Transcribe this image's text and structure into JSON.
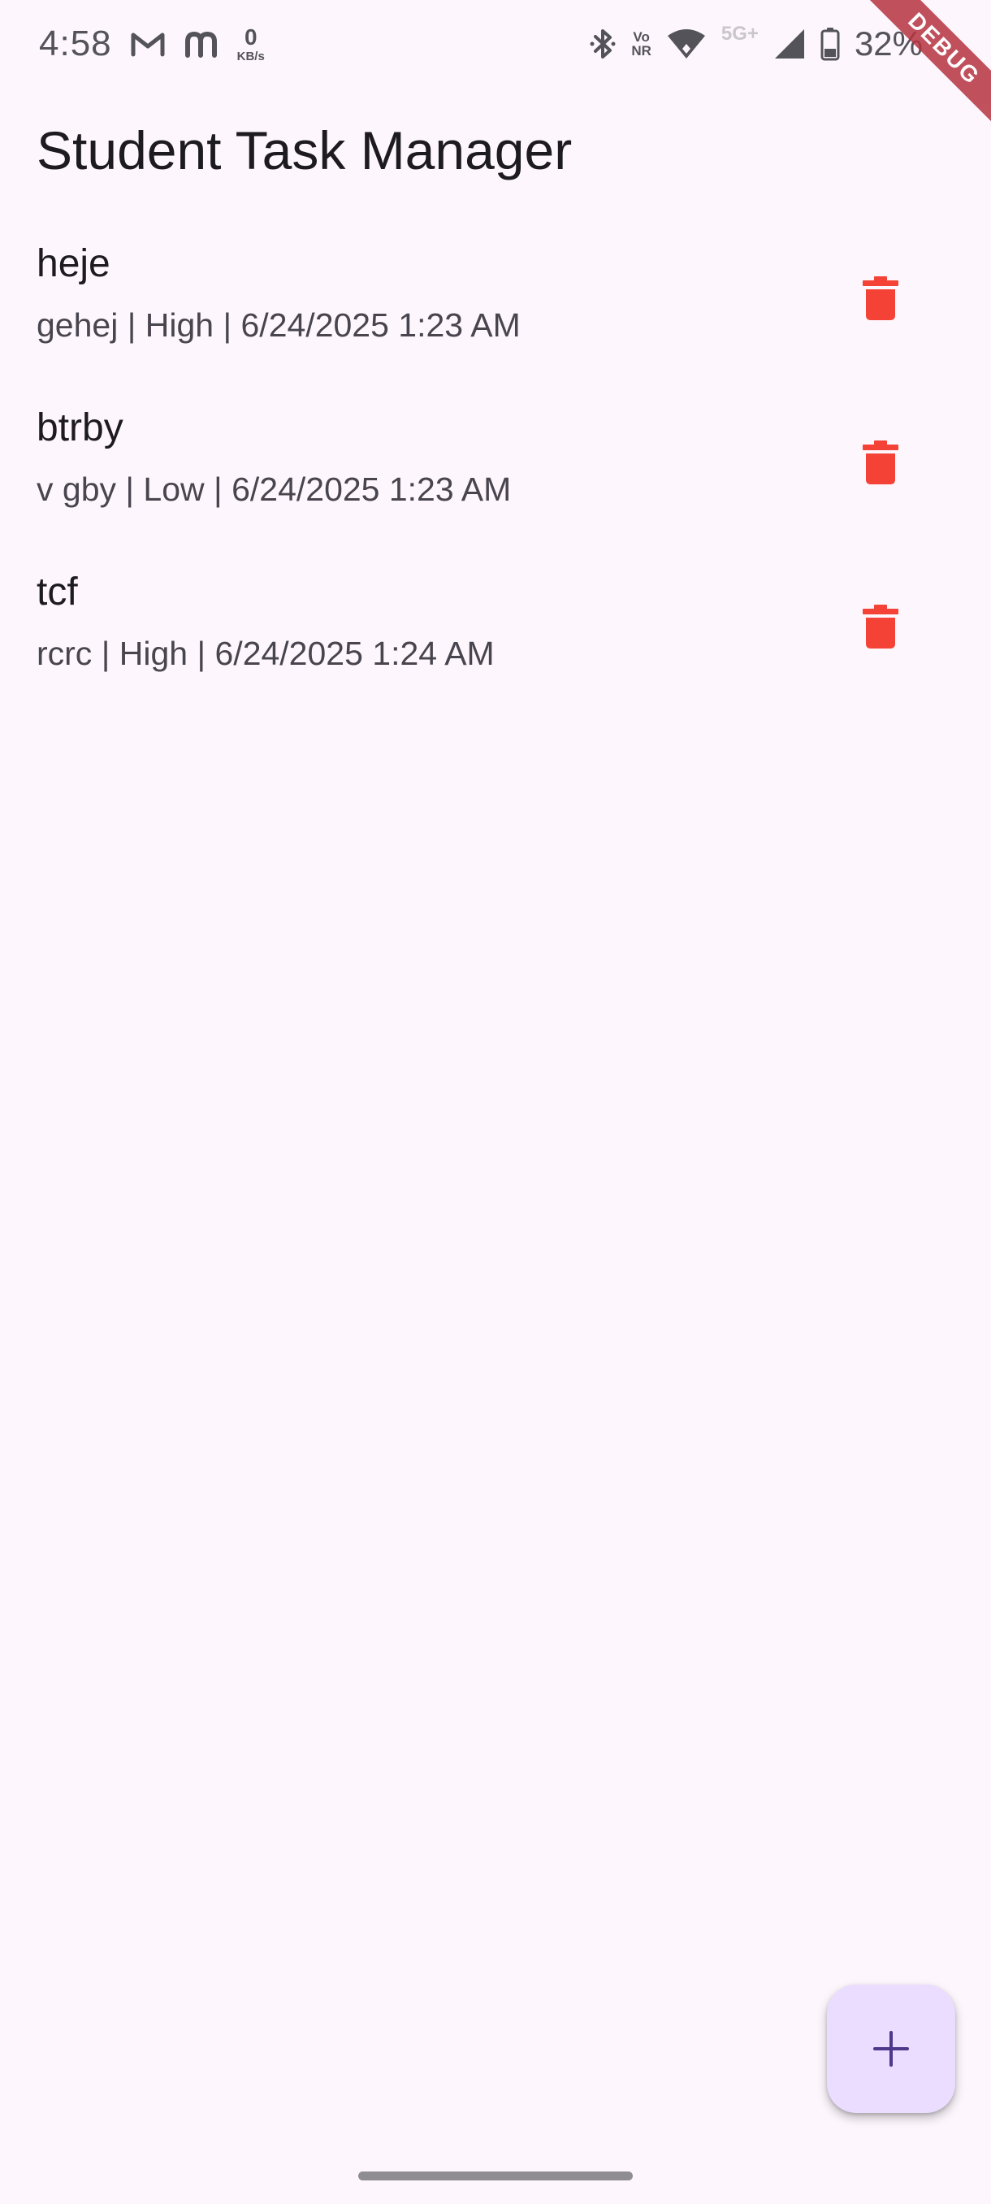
{
  "status_bar": {
    "time": "4:58",
    "net_speed_value": "0",
    "net_speed_unit": "KB/s",
    "volte_top": "Vo",
    "volte_bottom": "NR",
    "network_type": "5G+",
    "battery": "32%",
    "icons": [
      "gmail-icon",
      "m-app-icon",
      "bluetooth-icon",
      "volte-icon",
      "wifi-icon",
      "signal-icon",
      "battery-icon"
    ]
  },
  "debug_banner": "DEBUG",
  "app_bar": {
    "title": "Student Task Manager"
  },
  "tasks": [
    {
      "title": "heje",
      "subtitle": "gehej | High | 6/24/2025 1:23 AM"
    },
    {
      "title": "btrby",
      "subtitle": "v gby | Low | 6/24/2025 1:23 AM"
    },
    {
      "title": "tcf",
      "subtitle": "rcrc | High | 6/24/2025 1:24 AM"
    }
  ],
  "fab": {
    "icon": "add-icon"
  },
  "colors": {
    "background": "#fdf7fd",
    "delete_icon": "#f44336",
    "fab_background": "#eaddff",
    "fab_icon": "#4f378b",
    "debug_banner": "#b6343f"
  }
}
